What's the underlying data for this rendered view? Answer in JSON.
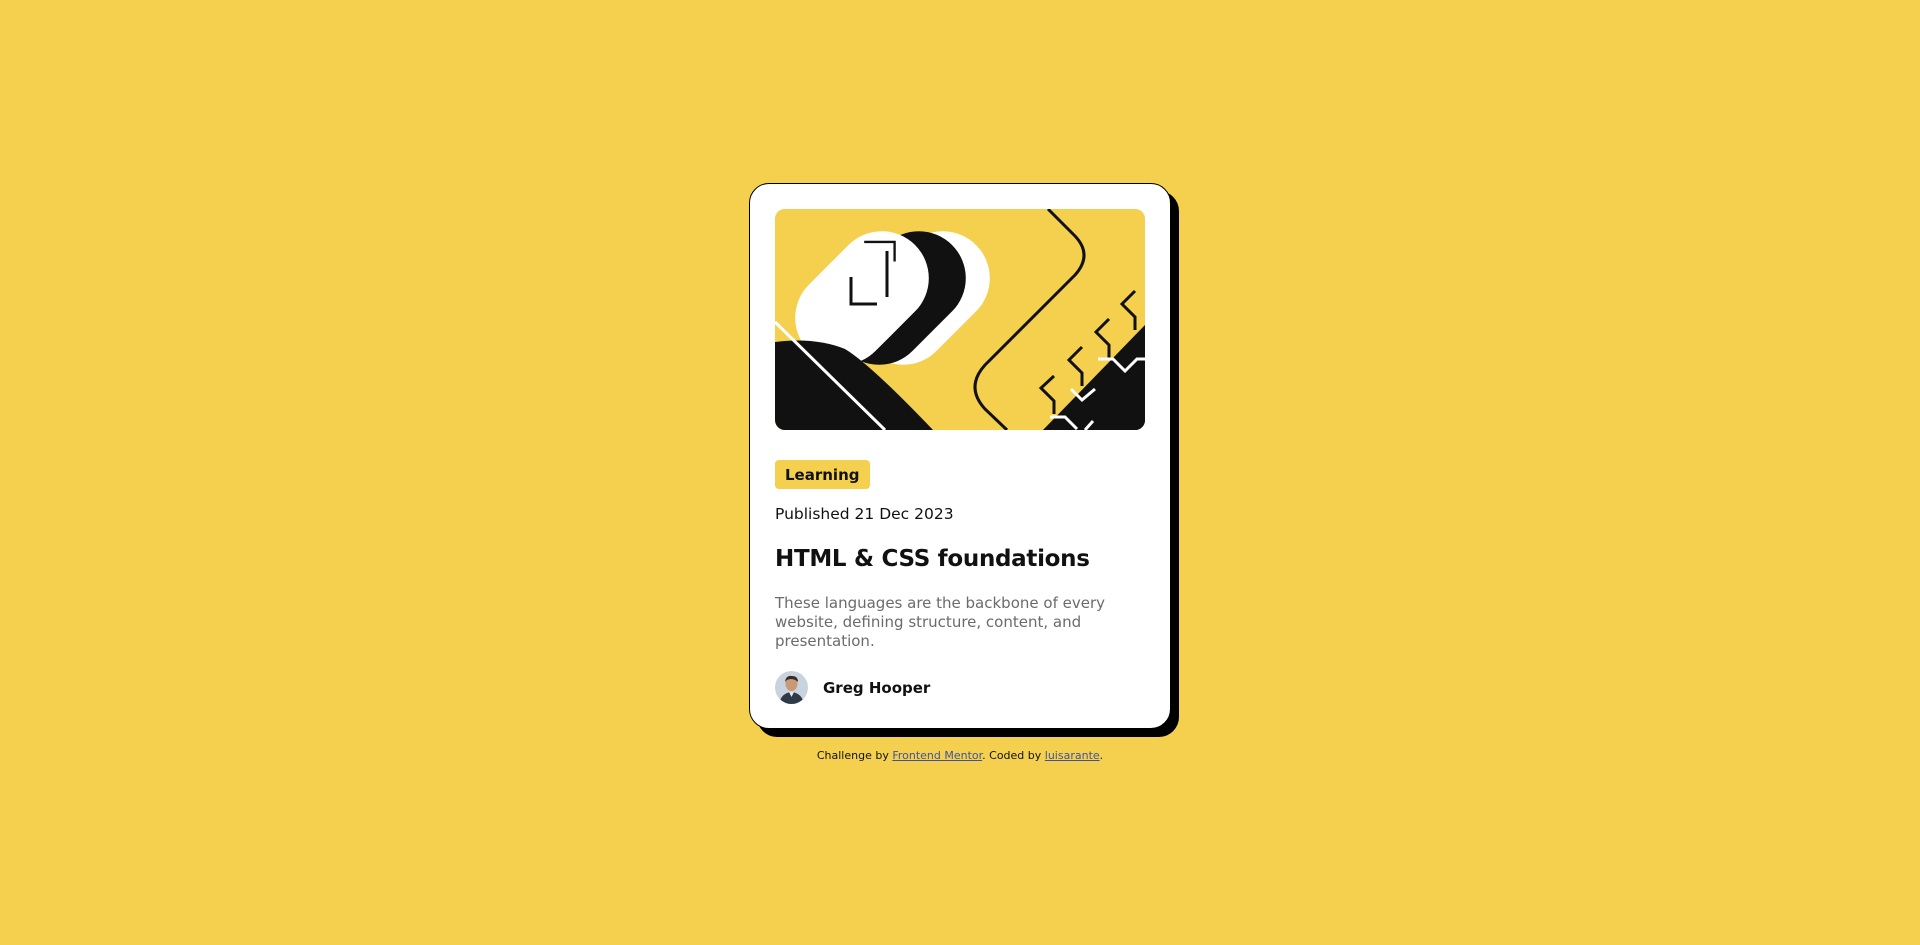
{
  "colors": {
    "background": "#F4D04E",
    "card": "#FFFFFF",
    "ink": "#111111",
    "muted": "#6B6B6B",
    "link": "#3E52A3"
  },
  "card": {
    "image_icon": "abstract-illustration",
    "tag": "Learning",
    "published": "Published 21 Dec 2023",
    "title": "HTML & CSS foundations",
    "excerpt": "These languages are the backbone of every website, defining structure, content, and presentation.",
    "author": {
      "avatar_icon": "person-avatar",
      "name": "Greg Hooper"
    }
  },
  "attribution": {
    "prefix": "Challenge by ",
    "link1": "Frontend Mentor",
    "middle": ". Coded by ",
    "link2": "luisarante",
    "suffix": "."
  }
}
